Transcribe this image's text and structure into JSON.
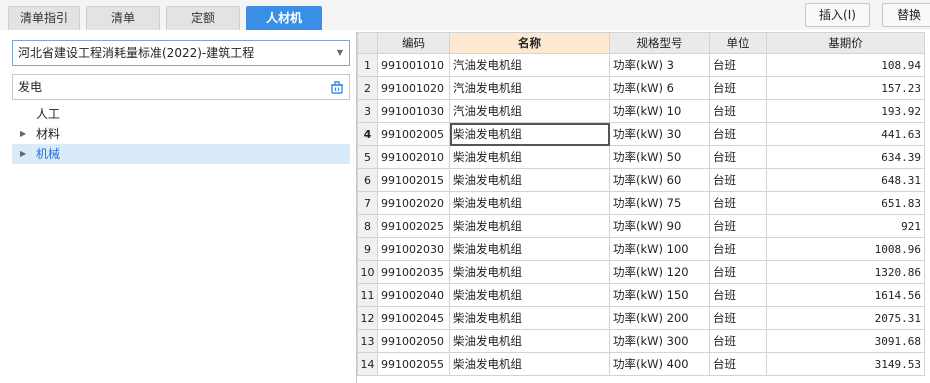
{
  "tabs": [
    {
      "label": "清单指引",
      "active": false
    },
    {
      "label": "清单",
      "active": false
    },
    {
      "label": "定额",
      "active": false
    },
    {
      "label": "人材机",
      "active": true
    }
  ],
  "actions": {
    "insert_label": "插入(I)",
    "replace_label": "替换"
  },
  "library_select": {
    "value": "河北省建设工程消耗量标准(2022)-建筑工程"
  },
  "search": {
    "value": "发电",
    "icon": "clear-search-icon"
  },
  "tree": [
    {
      "label": "人工",
      "expandable": false,
      "selected": false
    },
    {
      "label": "材料",
      "expandable": true,
      "selected": false
    },
    {
      "label": "机械",
      "expandable": true,
      "selected": true
    }
  ],
  "grid": {
    "headers": [
      "编码",
      "名称",
      "规格型号",
      "单位",
      "基期价"
    ],
    "rows": [
      {
        "n": "1",
        "code": "991001010",
        "name": "汽油发电机组",
        "spec": "功率(kW) 3",
        "unit": "台班",
        "price": "108.94"
      },
      {
        "n": "2",
        "code": "991001020",
        "name": "汽油发电机组",
        "spec": "功率(kW) 6",
        "unit": "台班",
        "price": "157.23"
      },
      {
        "n": "3",
        "code": "991001030",
        "name": "汽油发电机组",
        "spec": "功率(kW) 10",
        "unit": "台班",
        "price": "193.92"
      },
      {
        "n": "4",
        "code": "991002005",
        "name": "柴油发电机组",
        "spec": "功率(kW) 30",
        "unit": "台班",
        "price": "441.63"
      },
      {
        "n": "5",
        "code": "991002010",
        "name": "柴油发电机组",
        "spec": "功率(kW) 50",
        "unit": "台班",
        "price": "634.39"
      },
      {
        "n": "6",
        "code": "991002015",
        "name": "柴油发电机组",
        "spec": "功率(kW) 60",
        "unit": "台班",
        "price": "648.31"
      },
      {
        "n": "7",
        "code": "991002020",
        "name": "柴油发电机组",
        "spec": "功率(kW) 75",
        "unit": "台班",
        "price": "651.83"
      },
      {
        "n": "8",
        "code": "991002025",
        "name": "柴油发电机组",
        "spec": "功率(kW) 90",
        "unit": "台班",
        "price": "921"
      },
      {
        "n": "9",
        "code": "991002030",
        "name": "柴油发电机组",
        "spec": "功率(kW) 100",
        "unit": "台班",
        "price": "1008.96"
      },
      {
        "n": "10",
        "code": "991002035",
        "name": "柴油发电机组",
        "spec": "功率(kW) 120",
        "unit": "台班",
        "price": "1320.86"
      },
      {
        "n": "11",
        "code": "991002040",
        "name": "柴油发电机组",
        "spec": "功率(kW) 150",
        "unit": "台班",
        "price": "1614.56"
      },
      {
        "n": "12",
        "code": "991002045",
        "name": "柴油发电机组",
        "spec": "功率(kW) 200",
        "unit": "台班",
        "price": "2075.31"
      },
      {
        "n": "13",
        "code": "991002050",
        "name": "柴油发电机组",
        "spec": "功率(kW) 300",
        "unit": "台班",
        "price": "3091.68"
      },
      {
        "n": "14",
        "code": "991002055",
        "name": "柴油发电机组",
        "spec": "功率(kW) 400",
        "unit": "台班",
        "price": "3149.53"
      }
    ],
    "current_row": "4"
  },
  "colors": {
    "accent": "#3a8ee6",
    "selection": "#d9ebfb",
    "name_header": "#fde9d2"
  }
}
